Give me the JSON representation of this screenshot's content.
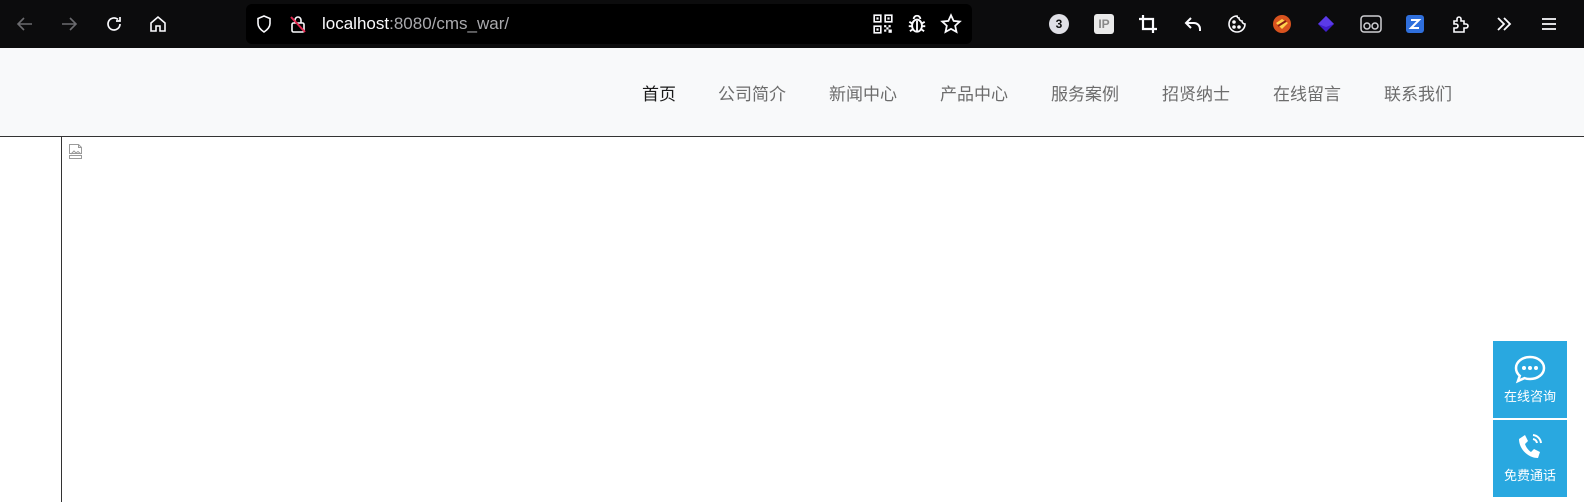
{
  "browser": {
    "url": {
      "host": "localhost",
      "rest": ":8080/cms_war/"
    },
    "extension_badge": "3",
    "extension_ip_label": "IP",
    "icons": {
      "back": "back-arrow-icon",
      "forward": "forward-arrow-icon",
      "reload": "reload-icon",
      "home": "home-icon",
      "shield": "shield-icon",
      "insecure": "insecure-lock-icon",
      "qr": "qr-code-icon",
      "bug": "bug-icon",
      "bookmark": "star-icon"
    }
  },
  "nav": {
    "items": [
      {
        "label": "首页",
        "active": true
      },
      {
        "label": "公司简介",
        "active": false
      },
      {
        "label": "新闻中心",
        "active": false
      },
      {
        "label": "产品中心",
        "active": false
      },
      {
        "label": "服务案例",
        "active": false
      },
      {
        "label": "招贤纳士",
        "active": false
      },
      {
        "label": "在线留言",
        "active": false
      },
      {
        "label": "联系我们",
        "active": false
      }
    ]
  },
  "float_panel": {
    "consult_label": "在线咨询",
    "call_label": "免费通话",
    "color": "#29a8e0"
  }
}
